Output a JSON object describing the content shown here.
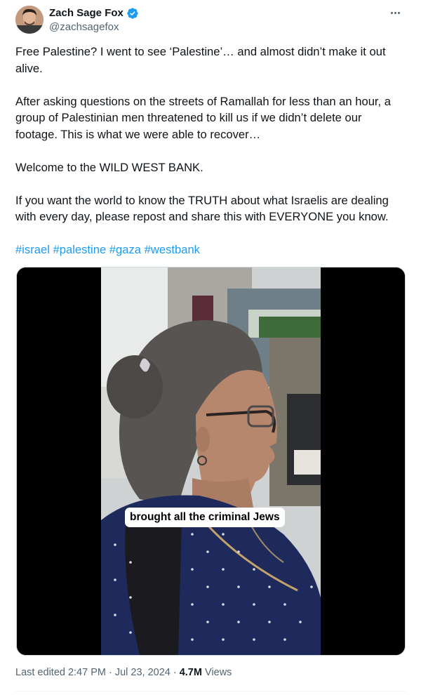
{
  "author": {
    "display_name": "Zach Sage Fox",
    "handle": "@zachsagefox",
    "verified": true,
    "verified_color": "#1d9bf0",
    "avatar_icon": "profile-photo"
  },
  "more_icon": "ellipsis-horizontal-icon",
  "tweet": {
    "paragraphs": [
      "Free Palestine? I went to see ‘Palestine’… and almost didn’t make it out alive.",
      "After asking questions on the streets of Ramallah for less than an hour, a group of Palestinian men threatened to kill us if we didn’t delete our footage. This is what we were able to recover…",
      "Welcome to the WILD WEST BANK.",
      "If you want the world to know the TRUTH about what Israelis are dealing with every day, please repost and share this with EVERYONE you know."
    ],
    "hashtags": [
      "#israel",
      "#palestine",
      "#gaza",
      "#westbank"
    ],
    "link_color": "#1d9bf0"
  },
  "media": {
    "caption": "brought all the criminal Jews"
  },
  "meta": {
    "edited_label": "Last edited",
    "time": "2:47 PM",
    "separator": "·",
    "date": "Jul 23, 2024",
    "views_count": "4.7M",
    "views_label": "Views"
  }
}
